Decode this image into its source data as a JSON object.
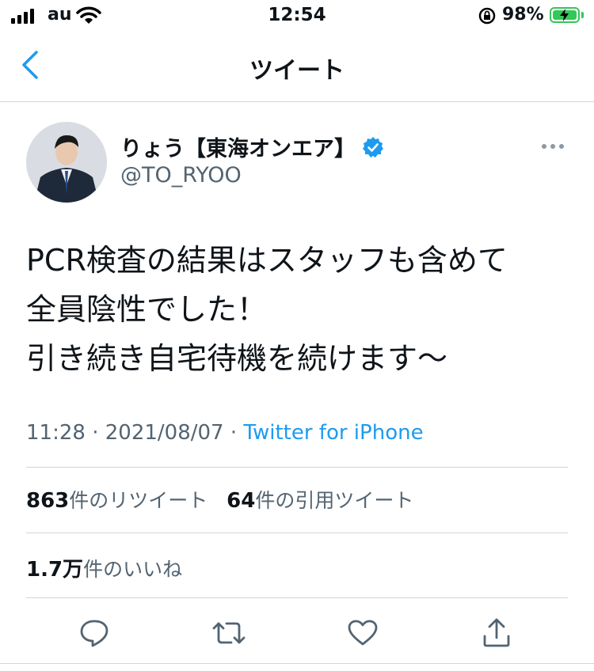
{
  "status_bar": {
    "carrier": "au",
    "time": "12:54",
    "battery": "98%"
  },
  "nav": {
    "title": "ツイート"
  },
  "tweet": {
    "display_name": "りょう【東海オンエア】",
    "handle": "@TO_RYOO",
    "text_lines": [
      "PCR検査の結果はスタッフも含めて",
      "全員陰性でした！",
      "引き続き自宅待機を続けます〜"
    ],
    "time": "11:28",
    "dot1": " · ",
    "date": "2021/08/07",
    "dot2": " · ",
    "source": "Twitter for iPhone",
    "retweets_count": "863",
    "retweets_label": "件のリツイート",
    "quotes_count": "64",
    "quotes_label": "件の引用ツイート",
    "likes_count": "1.7万",
    "likes_label": "件のいいね"
  },
  "icons": {
    "back": "chevron-left-icon",
    "verified": "verified-badge-icon",
    "more": "more-horizontal-icon",
    "reply": "reply-icon",
    "retweet": "retweet-icon",
    "like": "heart-icon",
    "share": "share-icon"
  },
  "colors": {
    "accent": "#1d9bf0",
    "secondary_text": "#536471",
    "battery": "#34c759"
  }
}
